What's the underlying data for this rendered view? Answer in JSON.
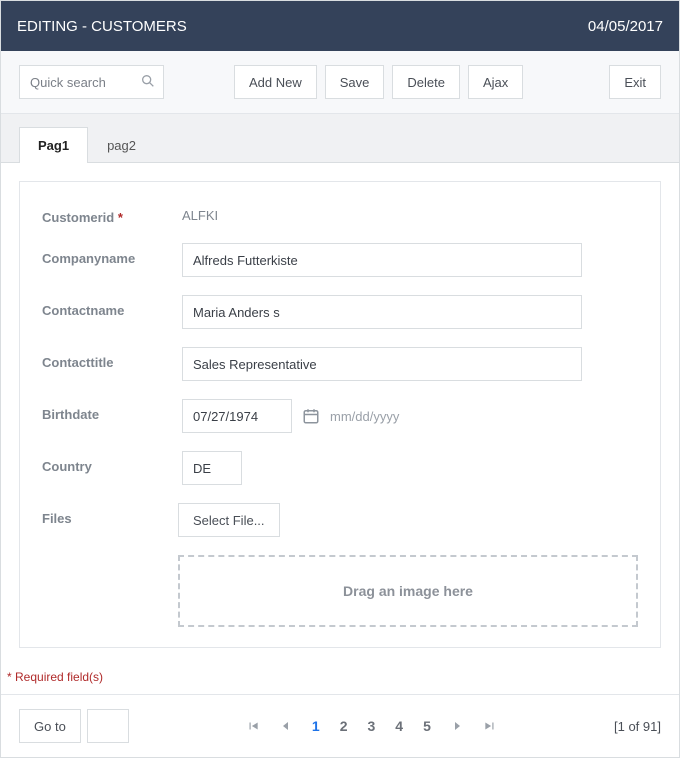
{
  "header": {
    "title": "EDITING - CUSTOMERS",
    "date": "04/05/2017"
  },
  "toolbar": {
    "search_placeholder": "Quick search",
    "search_value": "",
    "add_new": "Add New",
    "save": "Save",
    "delete": "Delete",
    "ajax": "Ajax",
    "exit": "Exit"
  },
  "tabs": {
    "t1": "Pag1",
    "t2": "pag2"
  },
  "form": {
    "customerid_label": "Customerid",
    "customerid_value": "ALFKI",
    "companyname_label": "Companyname",
    "companyname_value": "Alfreds Futterkiste",
    "contactname_label": "Contactname",
    "contactname_value": "Maria Anders s",
    "contacttitle_label": "Contacttitle",
    "contacttitle_value": "Sales Representative",
    "birthdate_label": "Birthdate",
    "birthdate_value": "07/27/1974",
    "birthdate_hint": "mm/dd/yyyy",
    "country_label": "Country",
    "country_value": "DE",
    "files_label": "Files",
    "select_file": "Select File...",
    "dropzone": "Drag an image here"
  },
  "required_note": "* Required field(s)",
  "footer": {
    "goto": "Go to",
    "goto_value": "",
    "pages": {
      "p1": "1",
      "p2": "2",
      "p3": "3",
      "p4": "4",
      "p5": "5"
    },
    "records": "[1 of 91]"
  }
}
